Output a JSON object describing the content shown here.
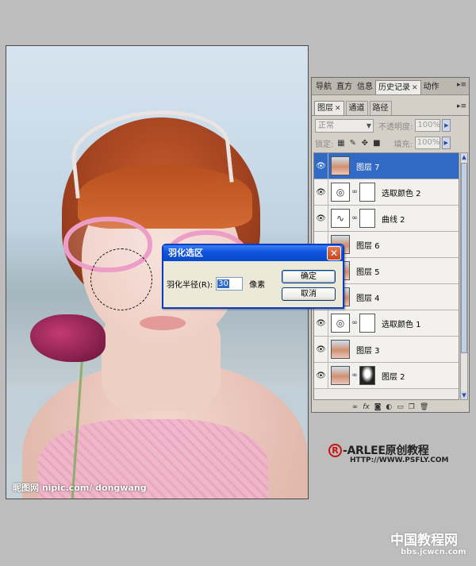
{
  "photo": {
    "watermark": "昵图网 nipic.com/ dongwang"
  },
  "panel": {
    "top_tabs": [
      {
        "label": "导航",
        "active": false
      },
      {
        "label": "直方",
        "active": false
      },
      {
        "label": "信息",
        "active": false
      },
      {
        "label": "历史记录",
        "active": true
      },
      {
        "label": "动作",
        "active": false
      }
    ],
    "tabs": [
      {
        "label": "图层",
        "active": true
      },
      {
        "label": "通道",
        "active": false
      },
      {
        "label": "路径",
        "active": false
      }
    ],
    "blend_mode": "正常",
    "opacity_label": "不透明度:",
    "opacity_value": "100%",
    "lock_label": "锁定:",
    "fill_label": "填充:",
    "fill_value": "100%",
    "layers": [
      {
        "name": "图层 7",
        "type": "image",
        "selected": true,
        "visible": true
      },
      {
        "name": "选取颜色 2",
        "type": "adjustment",
        "icon": "selective-color-icon",
        "selected": false,
        "visible": true
      },
      {
        "name": "曲线 2",
        "type": "adjustment",
        "icon": "curves-icon",
        "selected": false,
        "visible": true
      },
      {
        "name": "图层 6",
        "type": "image",
        "selected": false,
        "visible": false
      },
      {
        "name": "图层 5",
        "type": "image",
        "selected": false,
        "visible": false
      },
      {
        "name": "图层 4",
        "type": "image",
        "selected": false,
        "visible": false
      },
      {
        "name": "选取颜色 1",
        "type": "adjustment",
        "icon": "selective-color-icon",
        "selected": false,
        "visible": true
      },
      {
        "name": "图层 3",
        "type": "image",
        "selected": false,
        "visible": true
      },
      {
        "name": "图层 2",
        "type": "image-mask",
        "selected": false,
        "visible": true
      }
    ],
    "bottom_icons": [
      "link-icon",
      "fx-icon",
      "mask-icon",
      "adjustment-icon",
      "folder-icon",
      "new-layer-icon",
      "trash-icon"
    ]
  },
  "dialog": {
    "title": "羽化选区",
    "field_label": "羽化半径(R):",
    "field_value": "30",
    "unit": "像素",
    "ok_label": "确定",
    "cancel_label": "取消"
  },
  "branding": {
    "mark": "R",
    "name": "-ARLEE原创教程",
    "url": "HTTP://WWW.PSFLY.COM",
    "site_name": "中国教程网",
    "site_url": "bbs.jcwcn.com"
  },
  "colors": {
    "selection": "#316ac5",
    "dialog_title": "#0f55df",
    "brand_red": "#c81414"
  }
}
